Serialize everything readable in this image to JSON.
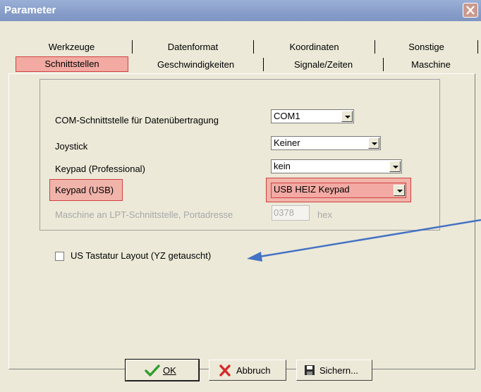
{
  "window": {
    "title": "Parameter"
  },
  "tabs_row1": [
    "Werkzeuge",
    "Datenformat",
    "Koordinaten",
    "Sonstige"
  ],
  "tabs_row2": [
    "Schnittstellen",
    "Geschwindigkeiten",
    "Signale/Zeiten",
    "Maschine"
  ],
  "settings": {
    "com_label": "COM-Schnittstelle für Datenübertragung",
    "com_value": "COM1",
    "joystick_label": "Joystick",
    "joystick_value": "Keiner",
    "keypad_pro_label": "Keypad (Professional)",
    "keypad_pro_value": "kein",
    "keypad_usb_label": "Keypad (USB)",
    "keypad_usb_value": "USB HEIZ Keypad",
    "lpt_label": "Maschine an LPT-Schnittstelle, Portadresse",
    "lpt_value": "0378",
    "lpt_unit": "hex"
  },
  "us_layout_label": "US Tastatur Layout (YZ getauscht)",
  "buttons": {
    "ok": "OK",
    "abbruch": "Abbruch",
    "sichern": "Sichern..."
  },
  "colors": {
    "highlight": "#f2aaa2",
    "highlight_border": "#d04040",
    "arrow": "#4472c4",
    "titlebar": "#8aa0cb"
  }
}
